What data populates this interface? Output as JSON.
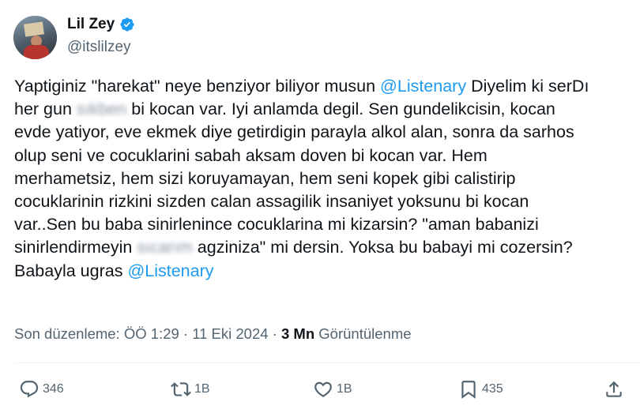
{
  "user": {
    "display_name": "Lil Zey",
    "handle": "@itslilzey",
    "verified": true,
    "avatar_icon": "avatar-photo"
  },
  "tweet": {
    "lines": [
      [
        "Yaptiginiz \"harekat\" neye benziyor biliyor musun ",
        "@Listenary",
        " Diyelim ki ser",
        "D",
        "ı"
      ],
      [
        "her gun ",
        "sıkben",
        " bi kocan var. Iyi anlamda degil. Sen gundelikcisin,  kocan"
      ],
      [
        "evde yatiyor, eve ekmek diye getirdigin parayla alkol alan, sonra da sarhos"
      ],
      [
        "olup seni ve cocuklarini sabah aksam doven bi kocan var. Hem"
      ],
      [
        "merhametsiz, hem sizi koruyamayan, hem seni kopek gibi calistirip"
      ],
      [
        "cocuklarinin rizkini sizden calan assagilik insaniyet yoksunu bi kocan"
      ],
      [
        "var..Sen bu baba sinirlenince cocuklarina mi kizarsin? \"aman babanizi"
      ],
      [
        "sinirlendirmeyin ",
        "sıcarım",
        " agziniza\" mi dersin. Yoksa bu babayi mi cozersin?"
      ],
      [
        "Babayla ugras ",
        "@Listenary"
      ]
    ],
    "mention": "@Listenary",
    "blurred_words": [
      "sıkben",
      "sıcarım"
    ]
  },
  "meta": {
    "edited_label": "Son düzenleme: ÖÖ 1:29 · 11 Eki 2024 · ",
    "views_count": "3 Mn",
    "views_label": " Görüntülenme"
  },
  "actions": {
    "reply_count": "346",
    "repost_count": "1B",
    "like_count": "1B",
    "bookmark_count": "435",
    "icons": [
      "reply-icon",
      "repost-icon",
      "like-icon",
      "bookmark-icon",
      "share-icon"
    ]
  },
  "colors": {
    "text": "#0f1419",
    "secondary": "#536471",
    "accent": "#1d9bf0"
  }
}
